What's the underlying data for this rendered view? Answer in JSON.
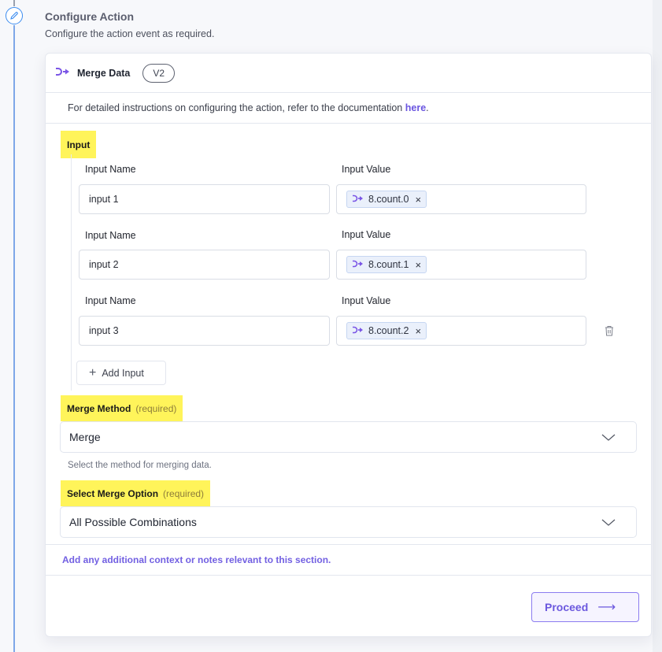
{
  "step": {
    "title": "Configure Action",
    "subtitle": "Configure the action event as required.",
    "icon": "pencil-icon"
  },
  "action": {
    "icon": "merge-icon",
    "name": "Merge Data",
    "version": "V2"
  },
  "doc": {
    "text": "For detailed instructions on configuring the action, refer to the documentation ",
    "link": "here",
    "suffix": "."
  },
  "input_section": {
    "label": "Input",
    "name_label": "Input Name",
    "value_label": "Input Value",
    "rows": [
      {
        "name": "input 1",
        "value": "8.count.0"
      },
      {
        "name": "input 2",
        "value": "8.count.1"
      },
      {
        "name": "input 3",
        "value": "8.count.2"
      }
    ],
    "add_label": "Add Input"
  },
  "merge_method": {
    "label": "Merge Method",
    "required": "(required)",
    "value": "Merge",
    "help": "Select the method for merging data."
  },
  "merge_option": {
    "label": "Select Merge Option",
    "required": "(required)",
    "value": "All Possible Combinations"
  },
  "notes": "Add any additional context or notes relevant to this section.",
  "proceed": {
    "label": "Proceed",
    "arrow": "⟶"
  },
  "colors": {
    "accent": "#6b58de",
    "highlight": "#fff45a",
    "timeline": "#7ea7e8"
  }
}
